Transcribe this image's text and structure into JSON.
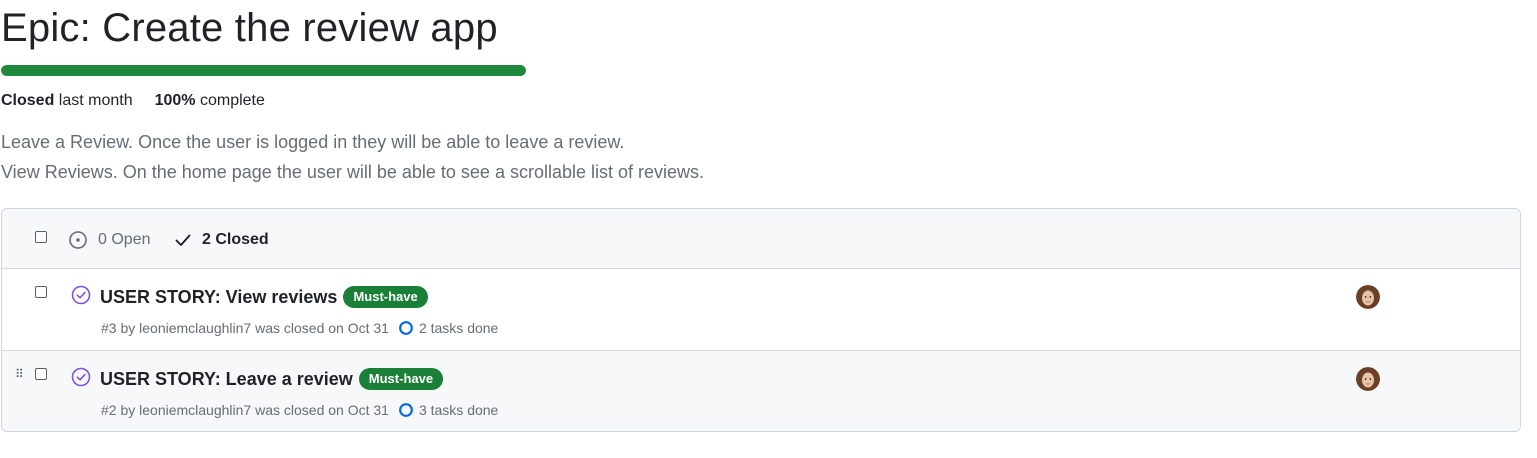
{
  "epic": {
    "title": "Epic: Create the review app",
    "progress_percent": 100,
    "status_strong": "Closed",
    "status_rest": " last month",
    "complete_strong": "100%",
    "complete_rest": " complete",
    "description": [
      "Leave a Review. Once the user is logged in they will be able to leave a review.",
      "View Reviews. On the home page the user will be able to see a scrollable list of reviews."
    ]
  },
  "list_header": {
    "open_label": "0 Open",
    "closed_label": "2 Closed"
  },
  "issues": [
    {
      "title": "USER STORY: View reviews",
      "label": "Must-have",
      "meta": "#3 by leoniemclaughlin7 was closed on Oct 31",
      "tasks": "2 tasks done"
    },
    {
      "title": "USER STORY: Leave a review",
      "label": "Must-have",
      "meta": "#2 by leoniemclaughlin7 was closed on Oct 31",
      "tasks": "3 tasks done"
    }
  ],
  "colors": {
    "progress": "#1f883d",
    "label_bg": "#1a7f37",
    "closed_icon": "#8250df",
    "tasks_icon": "#0969da"
  }
}
